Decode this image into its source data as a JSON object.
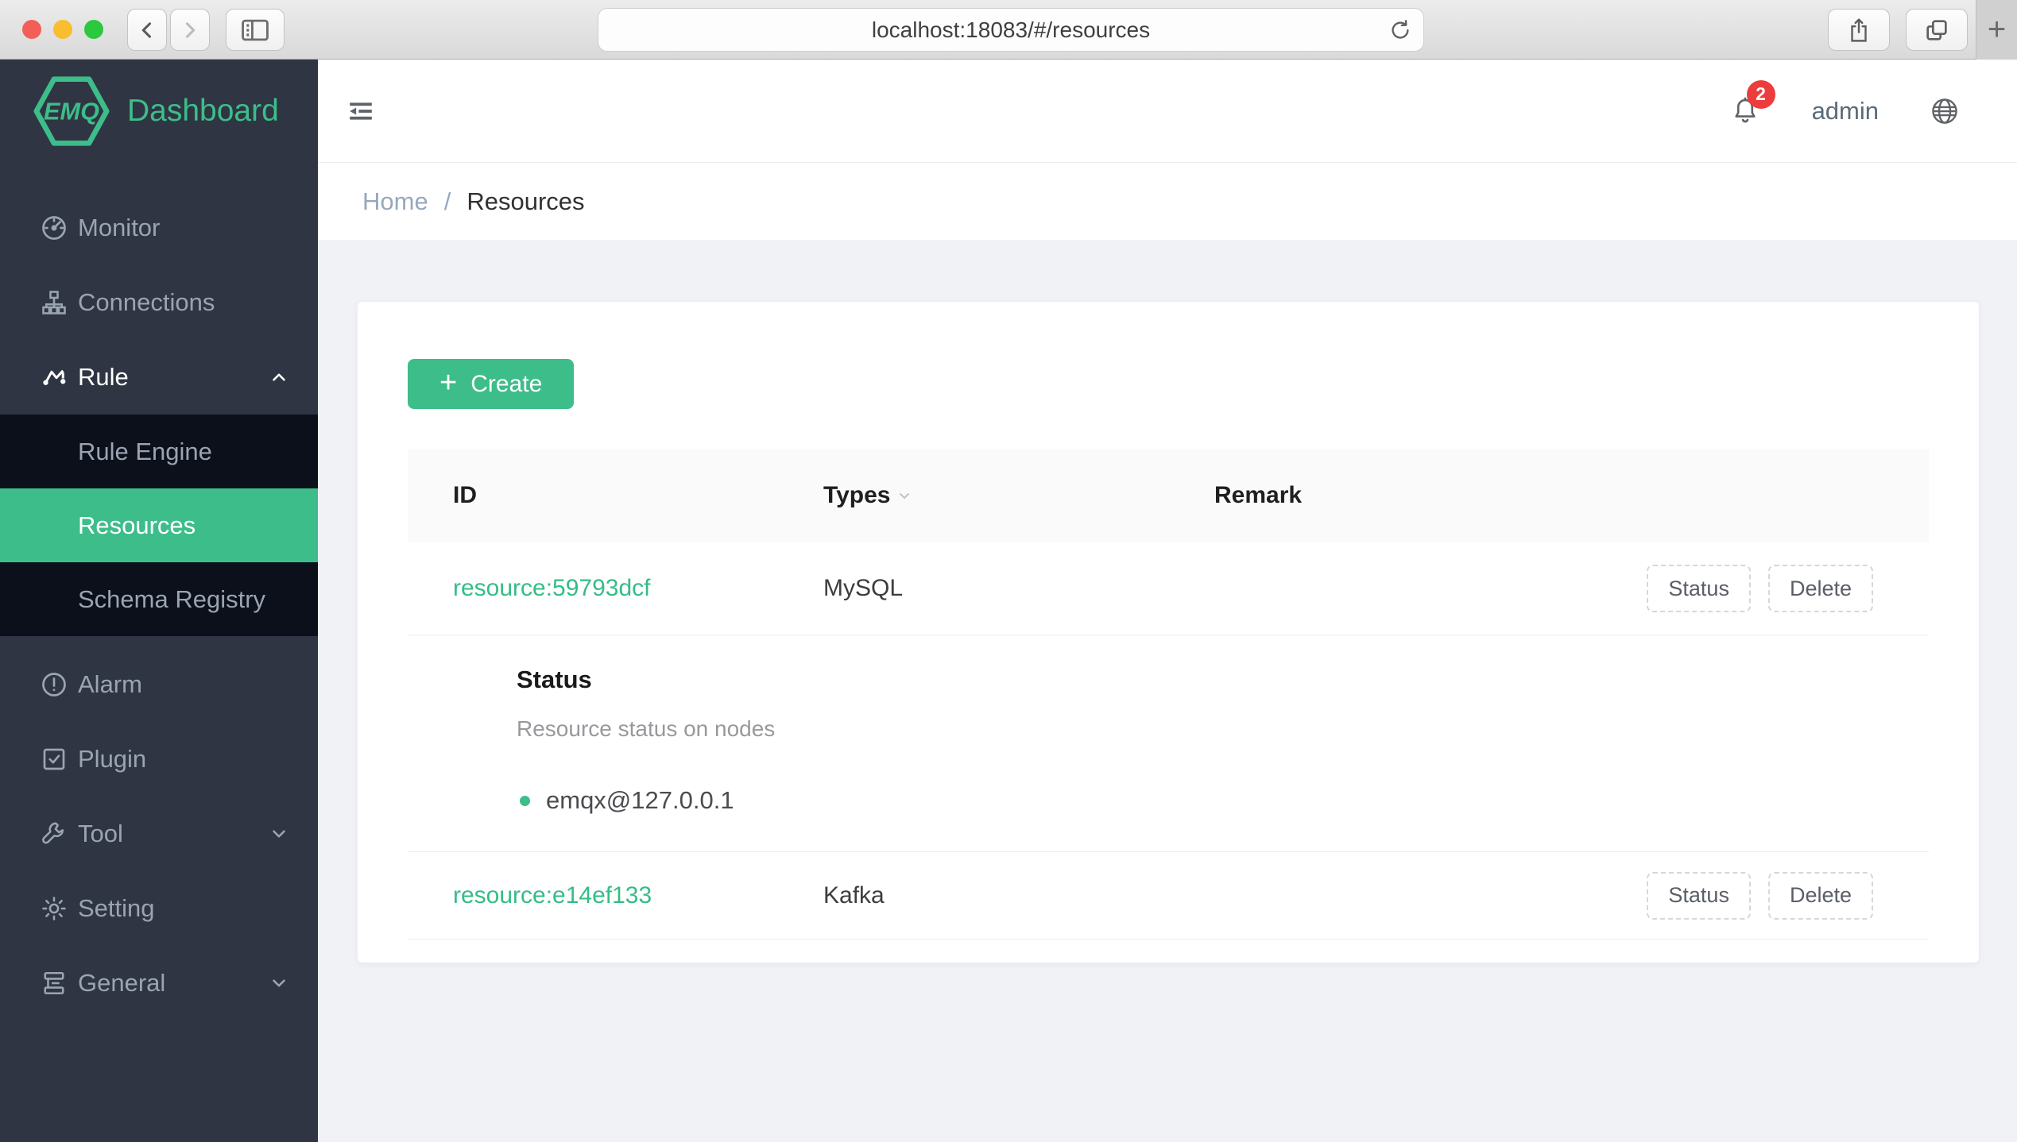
{
  "browser": {
    "url": "localhost:18083/#/resources",
    "new_tab_glyph": "+"
  },
  "sidebar": {
    "logo_text": "EMQ",
    "logo_title": "Dashboard",
    "items": [
      {
        "label": "Monitor"
      },
      {
        "label": "Connections"
      },
      {
        "label": "Rule"
      },
      {
        "label": "Alarm"
      },
      {
        "label": "Plugin"
      },
      {
        "label": "Tool"
      },
      {
        "label": "Setting"
      },
      {
        "label": "General"
      }
    ],
    "rule_submenu": [
      {
        "label": "Rule Engine"
      },
      {
        "label": "Resources"
      },
      {
        "label": "Schema Registry"
      }
    ]
  },
  "topbar": {
    "notification_count": "2",
    "username": "admin"
  },
  "breadcrumb": {
    "home": "Home",
    "separator": "/",
    "current": "Resources"
  },
  "page": {
    "create_label": "Create",
    "create_plus": "+",
    "table": {
      "columns": [
        "ID",
        "Types",
        "Remark"
      ],
      "action_status": "Status",
      "action_delete": "Delete",
      "rows": [
        {
          "id": "resource:59793dcf",
          "type": "MySQL",
          "remark": ""
        },
        {
          "id": "resource:e14ef133",
          "type": "Kafka",
          "remark": ""
        }
      ],
      "expanded_panel": {
        "title": "Status",
        "description": "Resource status on nodes",
        "nodes": [
          "emqx@127.0.0.1"
        ]
      }
    }
  },
  "colors": {
    "accent_green": "#3dbd8a",
    "link_green": "#34bd87",
    "sidebar_bg": "#2f3542",
    "submenu_bg": "#0b101b",
    "badge_red": "#ed3c3c"
  }
}
